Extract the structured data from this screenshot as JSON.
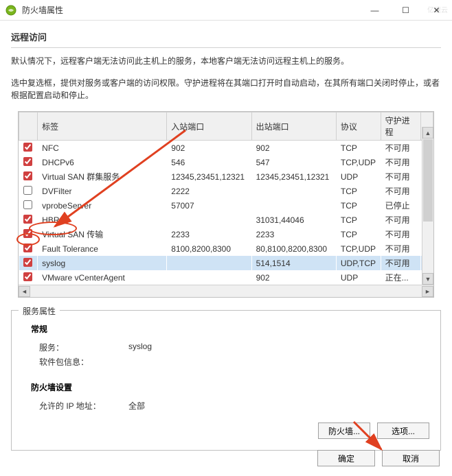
{
  "window": {
    "title": "防火墙属性",
    "min": "—",
    "max": "☐",
    "close": "✕"
  },
  "remote_access": {
    "heading": "远程访问",
    "desc1": "默认情况下，远程客户端无法访问此主机上的服务，本地客户端无法访问远程主机上的服务。",
    "desc2": "选中复选框，提供对服务或客户端的访问权限。守护进程将在其端口打开时自动启动，在其所有端口关闭时停止，或者根据配置启动和停止。"
  },
  "columns": {
    "label": "标签",
    "ingress": "入站端口",
    "egress": "出站端口",
    "protocol": "协议",
    "daemon": "守护进程"
  },
  "rows": [
    {
      "checked": true,
      "label": "NFC",
      "in": "902",
      "out": "902",
      "proto": "TCP",
      "daemon": "不可用"
    },
    {
      "checked": true,
      "label": "DHCPv6",
      "in": "546",
      "out": "547",
      "proto": "TCP,UDP",
      "daemon": "不可用"
    },
    {
      "checked": true,
      "label": "Virtual SAN 群集服务",
      "in": "12345,23451,12321",
      "out": "12345,23451,12321",
      "proto": "UDP",
      "daemon": "不可用"
    },
    {
      "checked": false,
      "label": "DVFilter",
      "in": "2222",
      "out": "",
      "proto": "TCP",
      "daemon": "不可用"
    },
    {
      "checked": false,
      "label": "vprobeServer",
      "in": "57007",
      "out": "",
      "proto": "TCP",
      "daemon": "已停止"
    },
    {
      "checked": true,
      "label": "HBR",
      "in": "",
      "out": "31031,44046",
      "proto": "TCP",
      "daemon": "不可用"
    },
    {
      "checked": true,
      "label": "Virtual SAN 传输",
      "in": "2233",
      "out": "2233",
      "proto": "TCP",
      "daemon": "不可用"
    },
    {
      "checked": true,
      "label": "Fault Tolerance",
      "in": "8100,8200,8300",
      "out": "80,8100,8200,8300",
      "proto": "TCP,UDP",
      "daemon": "不可用"
    },
    {
      "checked": true,
      "label": "syslog",
      "in": "",
      "out": "514,1514",
      "proto": "UDP,TCP",
      "daemon": "不可用",
      "selected": true
    },
    {
      "checked": true,
      "label": "VMware vCenterAgent",
      "in": "",
      "out": "902",
      "proto": "UDP",
      "daemon": "正在..."
    }
  ],
  "svc_props": {
    "legend": "服务属性",
    "general": "常规",
    "service_k": "服务：",
    "service_v": "syslog",
    "package_k": "软件包信息：",
    "package_v": "",
    "fw_settings": "防火墙设置",
    "allowed_ip_k": "允许的 IP 地址：",
    "allowed_ip_v": "全部",
    "firewall_btn": "防火墙...",
    "options_btn": "选项..."
  },
  "dialog": {
    "ok": "确定",
    "cancel": "取消"
  },
  "watermark": "亿速云"
}
